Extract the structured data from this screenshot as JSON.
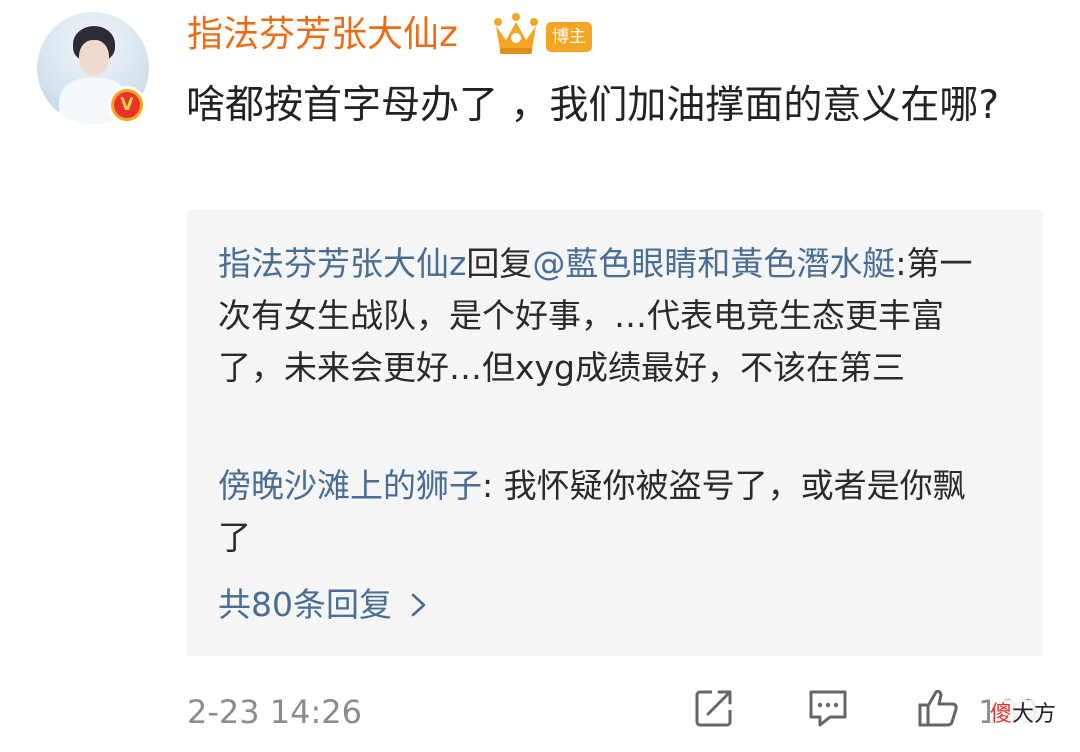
{
  "post": {
    "username": "指法芬芳张大仙z",
    "author_badge": "博主",
    "verified_badge": "V",
    "comment_text": "啥都按首字母办了 ，我们加油撑面的意义在哪?"
  },
  "replies": [
    {
      "author": "指法芬芳张大仙z",
      "reply_word": "回复",
      "mention": "@藍色眼睛和黃色潛水艇",
      "separator": ":",
      "text": "第一次有女生战队，是个好事，…代表电竞生态更丰富了，未来会更好…但xyg成绩最好，不该在第三"
    },
    {
      "author": "傍晚沙滩上的狮子",
      "separator": ": ",
      "text": "我怀疑你被盗号了，或者是你飘了"
    }
  ],
  "more_replies": "共80条回复",
  "footer": {
    "timestamp": "2-23 14:26",
    "like_count": "139"
  },
  "watermark": {
    "part1": "傻",
    "part2": "大方"
  },
  "icons": [
    "crown-icon",
    "verified-v-icon",
    "chevron-right-icon",
    "share-icon",
    "comment-icon",
    "like-icon"
  ],
  "colors": {
    "username": "#ef6c17",
    "badge": "#f5a524",
    "link": "#496e95",
    "meta": "#8c8c8c",
    "reply_bg": "#f5f5f5"
  }
}
